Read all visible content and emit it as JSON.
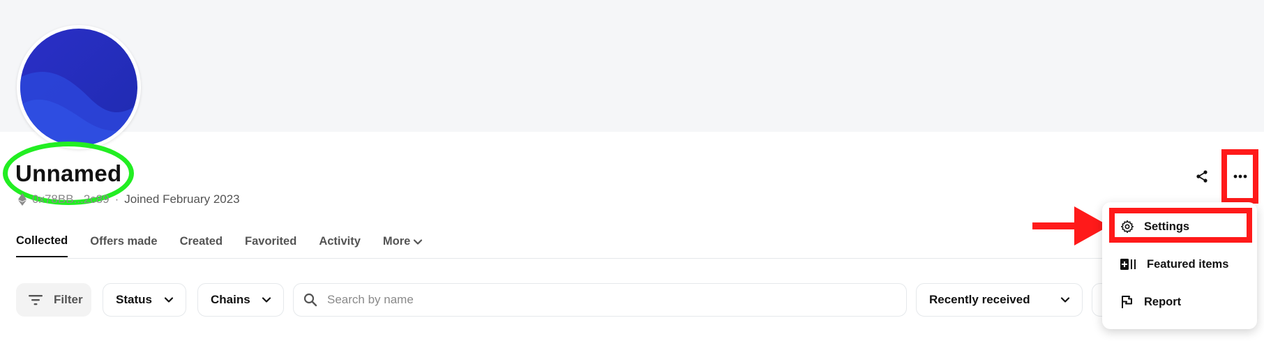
{
  "profile": {
    "name": "Unnamed",
    "address": "0x78BB...2c89",
    "joined": "Joined February 2023"
  },
  "tabs": [
    {
      "label": "Collected",
      "active": true
    },
    {
      "label": "Offers made",
      "active": false
    },
    {
      "label": "Created",
      "active": false
    },
    {
      "label": "Favorited",
      "active": false
    },
    {
      "label": "Activity",
      "active": false
    },
    {
      "label": "More",
      "active": false
    }
  ],
  "filters": {
    "filter_label": "Filter",
    "status_label": "Status",
    "chains_label": "Chains",
    "search_placeholder": "Search by name",
    "sort_label": "Recently received"
  },
  "menu": {
    "items": [
      {
        "label": "Settings",
        "icon": "gear-icon"
      },
      {
        "label": "Featured items",
        "icon": "featured-items-icon"
      },
      {
        "label": "Report",
        "icon": "flag-icon"
      }
    ]
  },
  "annotations": {
    "highlight_color": "#ff1a1a",
    "ring_color": "#22ee22"
  }
}
